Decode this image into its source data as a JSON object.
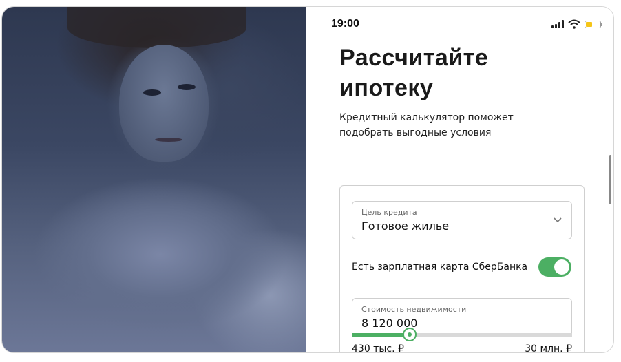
{
  "status_bar": {
    "time": "19:00"
  },
  "hero": {
    "title_line1": "Рассчитайте",
    "title_line2": "ипотеку",
    "subtitle": "Кредитный калькулятор поможет подобрать выгодные условия"
  },
  "calculator": {
    "purpose": {
      "label": "Цель кредита",
      "value": "Готовое жилье",
      "icon": "chevron-down-icon"
    },
    "salary_card": {
      "label": "Есть зарплатная карта СберБанка",
      "enabled": true,
      "accent_color": "#4caf63"
    },
    "property_cost": {
      "label": "Стоимость недвижимости",
      "value": "8 120 000",
      "slider_fraction": 0.26,
      "min_label": "430 тыс. ₽",
      "max_label": "30 млн. ₽"
    }
  },
  "colors": {
    "accent": "#4caf63",
    "battery": "#f5c518"
  }
}
